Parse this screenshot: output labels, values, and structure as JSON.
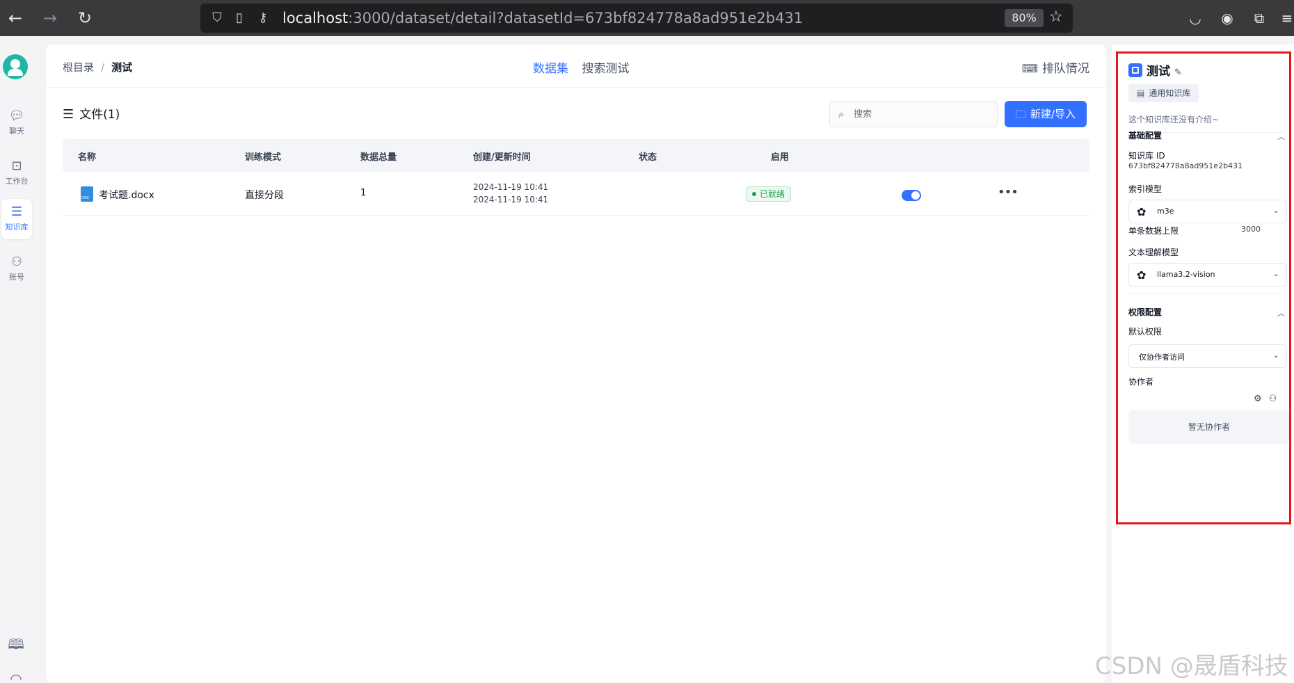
{
  "browser": {
    "url_host": "localhost",
    "url_path": ":3000/dataset/detail?datasetId=673bf824778a8ad951e2b431",
    "zoom": "80%"
  },
  "rail": {
    "items": [
      {
        "label": "聊天",
        "icon": "chat-icon"
      },
      {
        "label": "工作台",
        "icon": "robot-icon"
      },
      {
        "label": "知识库",
        "icon": "database-icon"
      },
      {
        "label": "账号",
        "icon": "user-icon"
      }
    ]
  },
  "header": {
    "breadcrumb_root": "根目录",
    "breadcrumb_sep": "/",
    "breadcrumb_current": "测试",
    "tabs": [
      "数据集",
      "搜索测试"
    ],
    "queue_label": "排队情况"
  },
  "files": {
    "title": "文件(1)",
    "search_placeholder": "搜索",
    "new_button": "新建/导入",
    "columns": [
      "名称",
      "训练模式",
      "数据总量",
      "创建/更新时间",
      "状态",
      "启用"
    ],
    "rows": [
      {
        "name": "考试题.docx",
        "mode": "直接分段",
        "count": "1",
        "created": "2024-11-19 10:41",
        "updated": "2024-11-19 10:41",
        "status": "已就绪",
        "enabled": true
      }
    ]
  },
  "detail": {
    "title": "测试",
    "type": "通用知识库",
    "intro": "这个知识库还没有介绍~",
    "basic_section": "基础配置",
    "id_label": "知识库 ID",
    "id_value": "673bf824778a8ad951e2b431",
    "index_model_label": "索引模型",
    "index_model": "m3e",
    "max_chunk_label": "单条数据上限",
    "max_chunk_value": "3000",
    "llm_label": "文本理解模型",
    "llm_model": "llama3.2-vision",
    "perm_section": "权限配置",
    "default_perm_label": "默认权限",
    "default_perm": "仅协作者访问",
    "collab_label": "协作者",
    "no_collab": "暂无协作者"
  },
  "watermark": "CSDN @晟盾科技",
  "colors": {
    "accent": "#3370ff",
    "status_green": "#1f9e52",
    "highlight_frame": "#e8151b"
  }
}
